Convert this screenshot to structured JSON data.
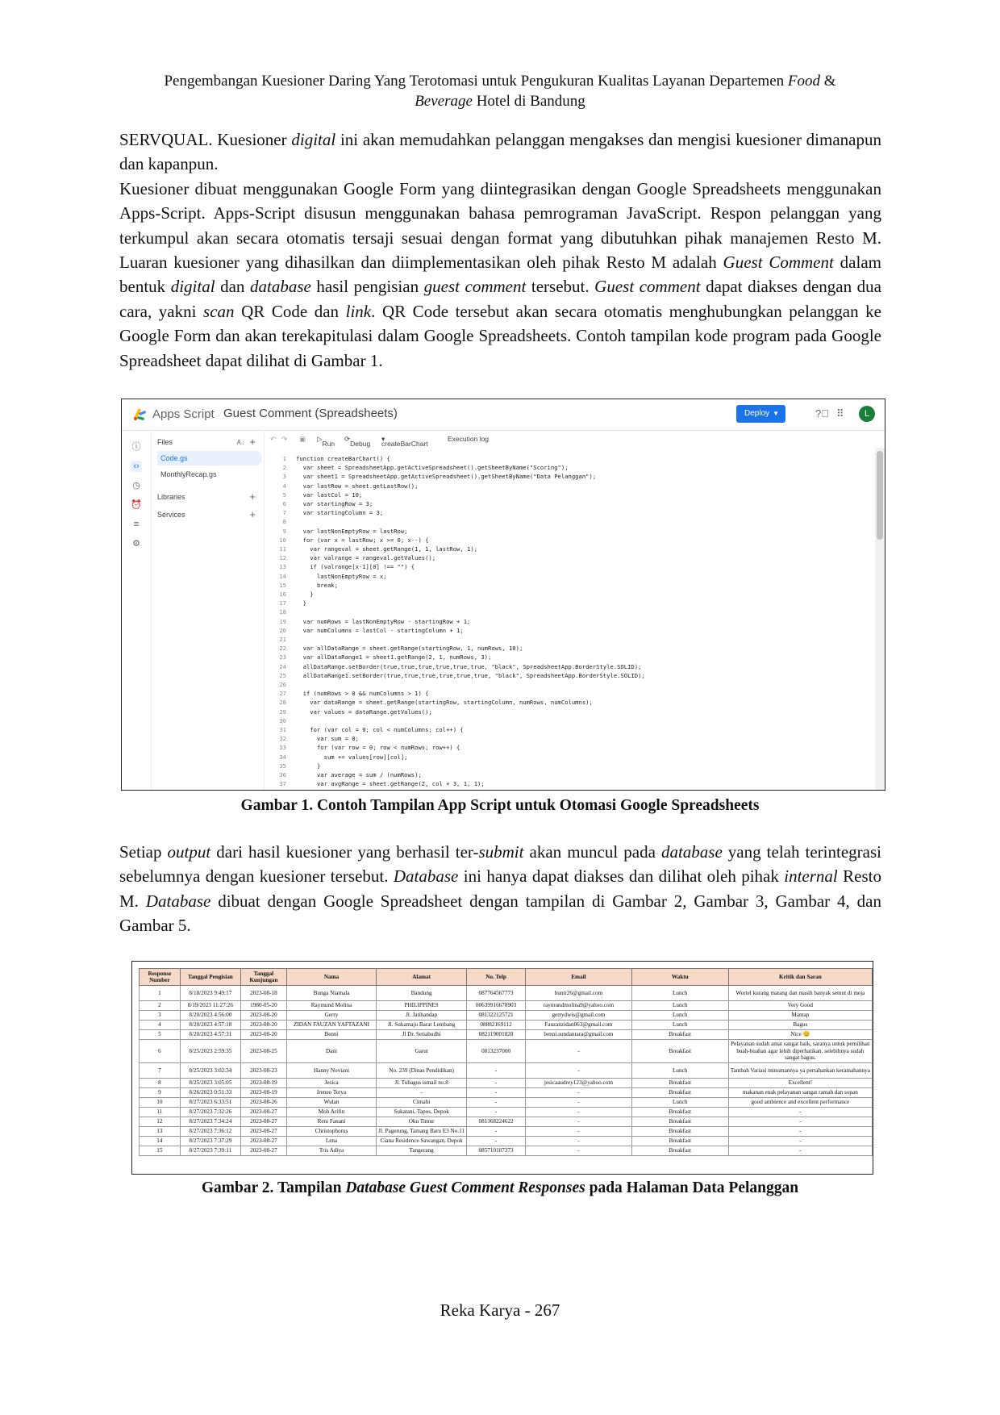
{
  "header": {
    "line1_prefix": "Pengembangan Kuesioner Daring Yang Terotomasi untuk Pengukuran Kualitas Layanan Departemen ",
    "line1_italic": "Food",
    "line1_suffix": " &",
    "line2_italic": "Beverage",
    "line2_suffix": " Hotel di Bandung"
  },
  "paragraph1": {
    "s1a": "SERVQUAL. Kuesioner ",
    "s1b": "digital",
    "s1c": " ini akan memudahkan pelanggan mengakses dan mengisi kuesioner dimanapun dan kapanpun.",
    "s2a": "Kuesioner dibuat menggunakan Google Form yang diintegrasikan dengan Google Spreadsheets menggunakan Apps-Script. Apps-Script disusun menggunakan bahasa pemrograman JavaScript. Respon pelanggan yang terkumpul akan secara otomatis tersaji sesuai dengan format yang dibutuhkan pihak manajemen Resto M. Luaran kuesioner yang dihasilkan dan diimplementasikan oleh pihak Resto M adalah ",
    "s2b": "Guest Comment",
    "s2c": " dalam bentuk ",
    "s2d": "digital",
    "s2e": " dan ",
    "s2f": "database",
    "s2g": " hasil pengisian ",
    "s2h": "guest comment",
    "s2i": " tersebut. ",
    "s2j": "Guest comment",
    "s2k": " dapat diakses dengan dua cara, yakni ",
    "s2l": "scan",
    "s2m": " QR Code dan ",
    "s2n": "link",
    "s2o": ". QR Code tersebut akan secara otomatis menghubungkan pelanggan ke Google Form dan akan terekapitulasi dalam Google Spreadsheets. Contoh tampilan kode program pada Google Spreadsheet dapat dilihat di Gambar 1."
  },
  "figure1": {
    "brand": "Apps Script",
    "project": "Guest Comment (Spreadsheets)",
    "deploy_label": "Deploy",
    "avatar": "L",
    "files_label": "Files",
    "files": [
      "Code.gs",
      "MonthlyRecap.gs"
    ],
    "libraries_label": "Libraries",
    "services_label": "Services",
    "toolbar": {
      "run": "Run",
      "debug": "Debug",
      "function": "createBarChart",
      "log": "Execution log"
    },
    "code_lines": [
      "function createBarChart() {",
      "  var sheet = SpreadsheetApp.getActiveSpreadsheet().getSheetByName(\"Scoring\");",
      "  var sheet1 = SpreadsheetApp.getActiveSpreadsheet().getSheetByName(\"Data Pelanggan\");",
      "  var lastRow = sheet.getLastRow();",
      "  var lastCol = 10;",
      "  var startingRow = 3;",
      "  var startingColumn = 3;",
      "",
      "  var lastNonEmptyRow = lastRow;",
      "  for (var x = lastRow; x >= 0; x--) {",
      "    var rangeval = sheet.getRange(1, 1, lastRow, 1);",
      "    var valrange = rangeval.getValues();",
      "    if (valrange[x-1][0] !== \"\") {",
      "      lastNonEmptyRow = x;",
      "      break;",
      "    }",
      "  }",
      "",
      "  var numRows = lastNonEmptyRow - startingRow + 1;",
      "  var numColumns = lastCol - startingColumn + 1;",
      "",
      "  var allDataRange = sheet.getRange(startingRow, 1, numRows, 10);",
      "  var allDataRange1 = sheet1.getRange(2, 1, numRows, 3);",
      "  allDataRange.setBorder(true,true,true,true,true,true, \"black\", SpreadsheetApp.BorderStyle.SOLID);",
      "  allDataRange1.setBorder(true,true,true,true,true,true, \"black\", SpreadsheetApp.BorderStyle.SOLID);",
      "",
      "  if (numRows > 0 && numColumns > 1) {",
      "    var dataRange = sheet.getRange(startingRow, startingColumn, numRows, numColumns);",
      "    var values = dataRange.getValues();",
      "",
      "    for (var col = 0; col < numColumns; col++) {",
      "      var sum = 0;",
      "      for (var row = 0; row < numRows; row++) {",
      "        sum += values[row][col];",
      "      }",
      "      var average = sum / (numRows);",
      "      var avgRange = sheet.getRange(2, col + 3, 1, 1);"
    ]
  },
  "caption1": "Gambar 1. Contoh Tampilan App Script untuk Otomasi Google Spreadsheets",
  "paragraph2": {
    "a": "Setiap ",
    "b": "output",
    "c": " dari hasil kuesioner yang berhasil ter-",
    "d": "submit",
    "e": " akan muncul pada ",
    "f": "database",
    "g": " yang telah terintegrasi sebelumnya dengan kuesioner tersebut. ",
    "h": "Database",
    "i": " ini hanya dapat diakses dan dilihat oleh pihak ",
    "j": "internal",
    "k": " Resto M. ",
    "l": "Database",
    "m": " dibuat dengan Google Spreadsheet dengan tampilan di Gambar 2, Gambar 3, Gambar 4, dan Gambar 5."
  },
  "figure2": {
    "headers": [
      "Response Number",
      "Tanggal Pengisian",
      "Tanggal Kunjungan",
      "Nama",
      "Alamat",
      "No. Telp",
      "Email",
      "Waktu",
      "Kritik dan Saran"
    ],
    "rows": [
      [
        "1",
        "8/18/2023 9:49:17",
        "2023-08-18",
        "Bunga Niamala",
        "Bandung",
        "087764567773",
        "bunir26@gmail.com",
        "Lunch",
        "Wortel kurang matang dan masih banyak semut di meja"
      ],
      [
        "2",
        "8/19/2023 11:27:26",
        "1980-05-20",
        "Raymund Molina",
        "PHILIPPINES",
        "00639916678903",
        "raymundmolina9@yahoo.com",
        "Lunch",
        "Very Good"
      ],
      [
        "3",
        "8/20/2023 4:56:00",
        "2023-08-20",
        "Gerry",
        "Jl. Jatihandap",
        "081322125721",
        "gerrydwis@gmail.com",
        "Lunch",
        "Mantap"
      ],
      [
        "4",
        "8/20/2023 4:57:18",
        "2023-08-20",
        "ZIDAN FAUZAN YAFTAZANI",
        "Jl. Sukamaju Barat Lembang",
        "08882169112",
        "Fauzanzidan063@gmail.com",
        "Lunch",
        "Bagus"
      ],
      [
        "5",
        "8/20/2023 4:57:31",
        "2023-08-20",
        "Benni",
        "Jl Dr. Setiabudhi",
        "082119001828",
        "benni.sundantara@gmail.com",
        "Breakfast",
        "Nice 😊"
      ],
      [
        "6",
        "8/25/2023 2:59:35",
        "2023-08-25",
        "Dani",
        "Garut",
        "0813237000",
        "-",
        "Breakfast",
        "Pelayanan sudah amat sangat baik, saranya untuk pemilihan buah-buahan agar lebih diperhatikan. selebihnya sudah sangat bagus."
      ],
      [
        "7",
        "8/25/2023 3:02:34",
        "2023-08-23",
        "Hanny Noviani",
        "No. 239 (Dinas Pendidikan)",
        "-",
        "-",
        "Lunch",
        "Tambah Variasi minumannya ya pertahankan keramahannya"
      ],
      [
        "8",
        "8/25/2023 3:05:05",
        "2023-08-19",
        "Jesica",
        "Jl. Tubagus ismail no.8",
        "-",
        "jesicaaudrey123@yahoo.com",
        "Breakfast",
        "Excellent!"
      ],
      [
        "9",
        "8/26/2023 0:51:33",
        "2023-08-19",
        "Ireneo Terya",
        "-",
        "-",
        "-",
        "Breakfast",
        "makanan enak pelayanan sangat ramah dan sopan"
      ],
      [
        "10",
        "8/27/2023 6:33:51",
        "2023-08-26",
        "Wulan",
        "Cimahi",
        "-",
        "-",
        "Lunch",
        "good ambience and excellent performance"
      ],
      [
        "11",
        "8/27/2023 7:32:26",
        "2023-08-27",
        "Moh Arifin",
        "Sukatani, Tapos, Depok",
        "-",
        "-",
        "Breakfast",
        "-"
      ],
      [
        "12",
        "8/27/2023 7:34:24",
        "2023-08-27",
        "Reni Fanani",
        "Oku Timur",
        "081368224622",
        "-",
        "Breakfast",
        "-"
      ],
      [
        "13",
        "8/27/2023 7:36:12",
        "2023-08-27",
        "Christophorus",
        "Jl. Pagerung, Tamang Baru E3 No.11",
        "-",
        "-",
        "Breakfast",
        "-"
      ],
      [
        "14",
        "8/27/2023 7:37:29",
        "2023-08-27",
        "Lena",
        "Ciana Residence Sawangan, Depok",
        "-",
        "-",
        "Breakfast",
        "-"
      ],
      [
        "15",
        "8/27/2023 7:39:11",
        "2023-08-27",
        "Tris Adiya",
        "Tangerang",
        "085710107373",
        "-",
        "Breakfast",
        "-"
      ]
    ]
  },
  "caption2": {
    "a": "Gambar 2. Tampilan ",
    "b": "Database Guest Comment Responses",
    "c": " pada Halaman Data Pelanggan"
  },
  "footer": "Reka Karya - 267"
}
